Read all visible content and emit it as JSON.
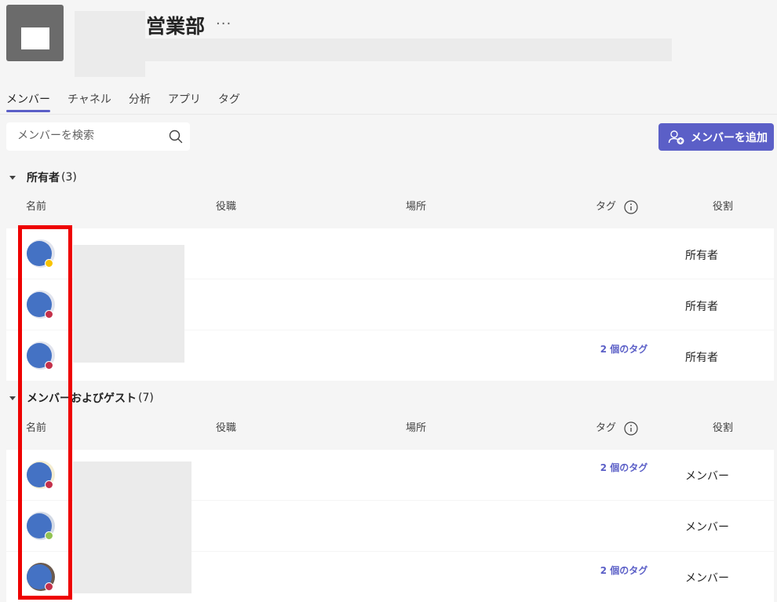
{
  "team": {
    "name": "営業部",
    "more": "···"
  },
  "tabs": [
    {
      "label": "メンバー",
      "active": true
    },
    {
      "label": "チャネル",
      "active": false
    },
    {
      "label": "分析",
      "active": false
    },
    {
      "label": "アプリ",
      "active": false
    },
    {
      "label": "タグ",
      "active": false
    }
  ],
  "search": {
    "placeholder": "メンバーを検索"
  },
  "add_member": {
    "label": "メンバーを追加"
  },
  "columns": {
    "name": "名前",
    "title": "役職",
    "location": "場所",
    "tags": "タグ",
    "role": "役割"
  },
  "owners": {
    "title": "所有者",
    "count": "(3)",
    "rows": [
      {
        "tags": "",
        "role": "所有者",
        "presence": "away",
        "presence_color": "#f8c300"
      },
      {
        "tags": "",
        "role": "所有者",
        "presence": "dnd",
        "presence_color": "#c4314b"
      },
      {
        "tags": "2 個のタグ",
        "role": "所有者",
        "presence": "busy",
        "presence_color": "#c4314b"
      }
    ]
  },
  "members": {
    "title": "メンバーおよびゲスト",
    "count": "(7)",
    "rows": [
      {
        "tags": "2 個のタグ",
        "role": "メンバー",
        "presence": "busy",
        "presence_color": "#c4314b"
      },
      {
        "tags": "",
        "role": "メンバー",
        "presence": "available",
        "presence_color": "#92c353"
      },
      {
        "tags": "2 個のタグ",
        "role": "メンバー",
        "presence": "busy",
        "presence_color": "#c4314b"
      }
    ]
  },
  "colors": {
    "accent": "#5b5fc7",
    "highlight": "#ee0000",
    "avatar": "#4472c4"
  }
}
